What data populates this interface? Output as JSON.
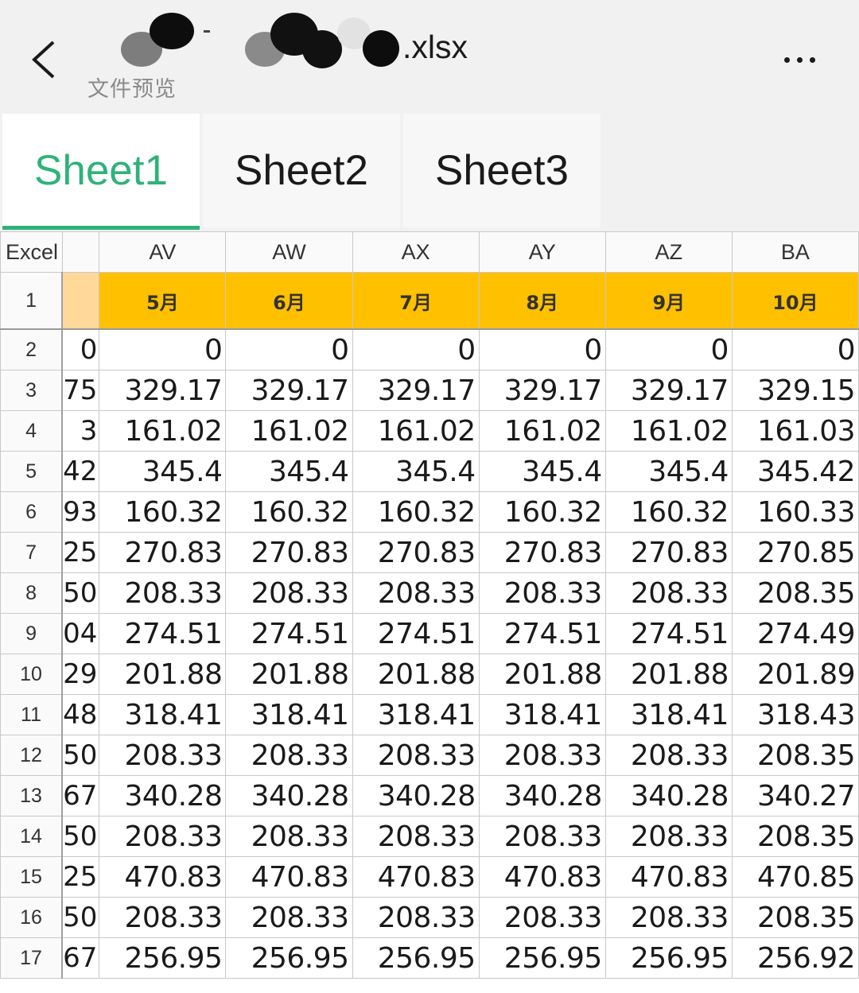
{
  "header": {
    "file_name_suffix": ".xlsx",
    "subtitle": "文件预览",
    "back_icon": "chevron-left-icon",
    "more_icon": "more-dots-icon"
  },
  "tabs": [
    {
      "label": "Sheet1",
      "active": true
    },
    {
      "label": "Sheet2",
      "active": false
    },
    {
      "label": "Sheet3",
      "active": false
    }
  ],
  "colors": {
    "accent": "#2fb27a",
    "header_fill": "#ffc000"
  },
  "grid": {
    "corner_label": "Excel",
    "columns": [
      "AV",
      "AW",
      "AX",
      "AY",
      "AZ",
      "BA"
    ],
    "month_row": {
      "row": "1",
      "values": [
        "5月",
        "6月",
        "7月",
        "8月",
        "9月",
        "10月"
      ]
    },
    "rows": [
      {
        "row": "2",
        "partial": "0",
        "values": [
          "0",
          "0",
          "0",
          "0",
          "0",
          "0"
        ]
      },
      {
        "row": "3",
        "partial": "75",
        "values": [
          "329.17",
          "329.17",
          "329.17",
          "329.17",
          "329.17",
          "329.15"
        ]
      },
      {
        "row": "4",
        "partial": "3",
        "values": [
          "161.02",
          "161.02",
          "161.02",
          "161.02",
          "161.02",
          "161.03"
        ]
      },
      {
        "row": "5",
        "partial": "42",
        "values": [
          "345.4",
          "345.4",
          "345.4",
          "345.4",
          "345.4",
          "345.42"
        ]
      },
      {
        "row": "6",
        "partial": "93",
        "values": [
          "160.32",
          "160.32",
          "160.32",
          "160.32",
          "160.32",
          "160.33"
        ]
      },
      {
        "row": "7",
        "partial": "25",
        "values": [
          "270.83",
          "270.83",
          "270.83",
          "270.83",
          "270.83",
          "270.85"
        ]
      },
      {
        "row": "8",
        "partial": "50",
        "values": [
          "208.33",
          "208.33",
          "208.33",
          "208.33",
          "208.33",
          "208.35"
        ]
      },
      {
        "row": "9",
        "partial": "04",
        "values": [
          "274.51",
          "274.51",
          "274.51",
          "274.51",
          "274.51",
          "274.49"
        ]
      },
      {
        "row": "10",
        "partial": "29",
        "values": [
          "201.88",
          "201.88",
          "201.88",
          "201.88",
          "201.88",
          "201.89"
        ]
      },
      {
        "row": "11",
        "partial": "48",
        "values": [
          "318.41",
          "318.41",
          "318.41",
          "318.41",
          "318.41",
          "318.43"
        ]
      },
      {
        "row": "12",
        "partial": "50",
        "values": [
          "208.33",
          "208.33",
          "208.33",
          "208.33",
          "208.33",
          "208.35"
        ]
      },
      {
        "row": "13",
        "partial": "67",
        "values": [
          "340.28",
          "340.28",
          "340.28",
          "340.28",
          "340.28",
          "340.27"
        ]
      },
      {
        "row": "14",
        "partial": "50",
        "values": [
          "208.33",
          "208.33",
          "208.33",
          "208.33",
          "208.33",
          "208.35"
        ]
      },
      {
        "row": "15",
        "partial": "25",
        "values": [
          "470.83",
          "470.83",
          "470.83",
          "470.83",
          "470.83",
          "470.85"
        ]
      },
      {
        "row": "16",
        "partial": "50",
        "values": [
          "208.33",
          "208.33",
          "208.33",
          "208.33",
          "208.33",
          "208.35"
        ]
      },
      {
        "row": "17",
        "partial": "67",
        "values": [
          "256.95",
          "256.95",
          "256.95",
          "256.95",
          "256.95",
          "256.92"
        ]
      }
    ]
  }
}
